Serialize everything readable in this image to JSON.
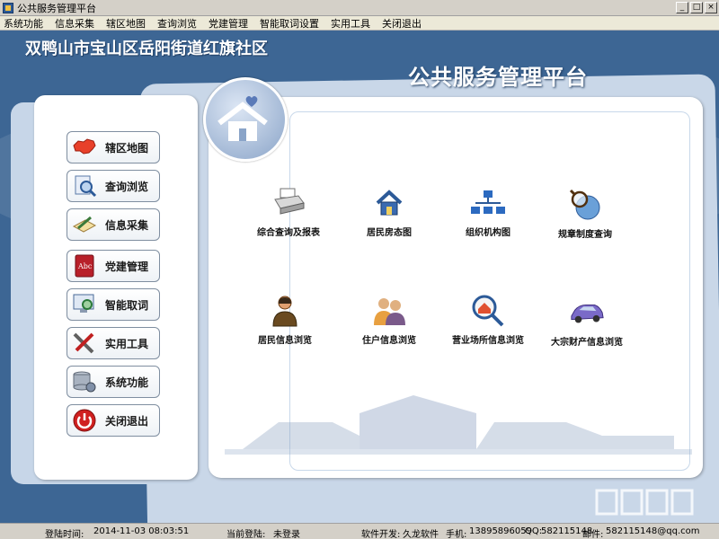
{
  "window": {
    "title": "公共服务管理平台",
    "btn_min": "_",
    "btn_max": "□",
    "btn_close": "×"
  },
  "menu": [
    "系统功能",
    "信息采集",
    "辖区地图",
    "查询浏览",
    "党建管理",
    "智能取词设置",
    "实用工具",
    "关闭退出"
  ],
  "header": {
    "community": "双鸭山市宝山区岳阳街道红旗社区",
    "platform": "公共服务管理平台"
  },
  "sidebar": [
    {
      "label": "辖区地图",
      "icon": "china-map-icon"
    },
    {
      "label": "查询浏览",
      "icon": "magnifier-document-icon"
    },
    {
      "label": "信息采集",
      "icon": "notebook-pen-icon"
    },
    {
      "label": "党建管理",
      "icon": "abc-book-icon"
    },
    {
      "label": "智能取词",
      "icon": "monitor-magnifier-icon"
    },
    {
      "label": "实用工具",
      "icon": "tools-icon"
    },
    {
      "label": "系统功能",
      "icon": "database-gear-icon"
    },
    {
      "label": "关闭退出",
      "icon": "power-icon"
    }
  ],
  "functions": [
    {
      "label": "综合查询及报表",
      "icon": "printer-icon"
    },
    {
      "label": "居民房态图",
      "icon": "house-icon"
    },
    {
      "label": "组织机构图",
      "icon": "org-chart-icon"
    },
    {
      "label": "规章制度查询",
      "icon": "globe-magnifier-icon"
    },
    {
      "label": "居民信息浏览",
      "icon": "resident-person-icon"
    },
    {
      "label": "住户信息浏览",
      "icon": "household-people-icon"
    },
    {
      "label": "营业场所信息浏览",
      "icon": "business-magnifier-icon"
    },
    {
      "label": "大宗财产信息浏览",
      "icon": "car-icon"
    }
  ],
  "status": {
    "login_time_label": "登陆时间:",
    "login_time": "2014-11-03 08:03:51",
    "current_login_label": "当前登陆:",
    "current_login": "未登录",
    "developer_label": "软件开发:",
    "developer": "久龙软件",
    "phone_label": "手机:",
    "phone": "13895896059",
    "qq_label": "QQ:",
    "qq": "582115148",
    "email_label": "邮件:",
    "email": "582115148@qq.com"
  },
  "colors": {
    "background": "#3d6694",
    "panel": "#ffffff",
    "accent": "#2c5a98"
  }
}
